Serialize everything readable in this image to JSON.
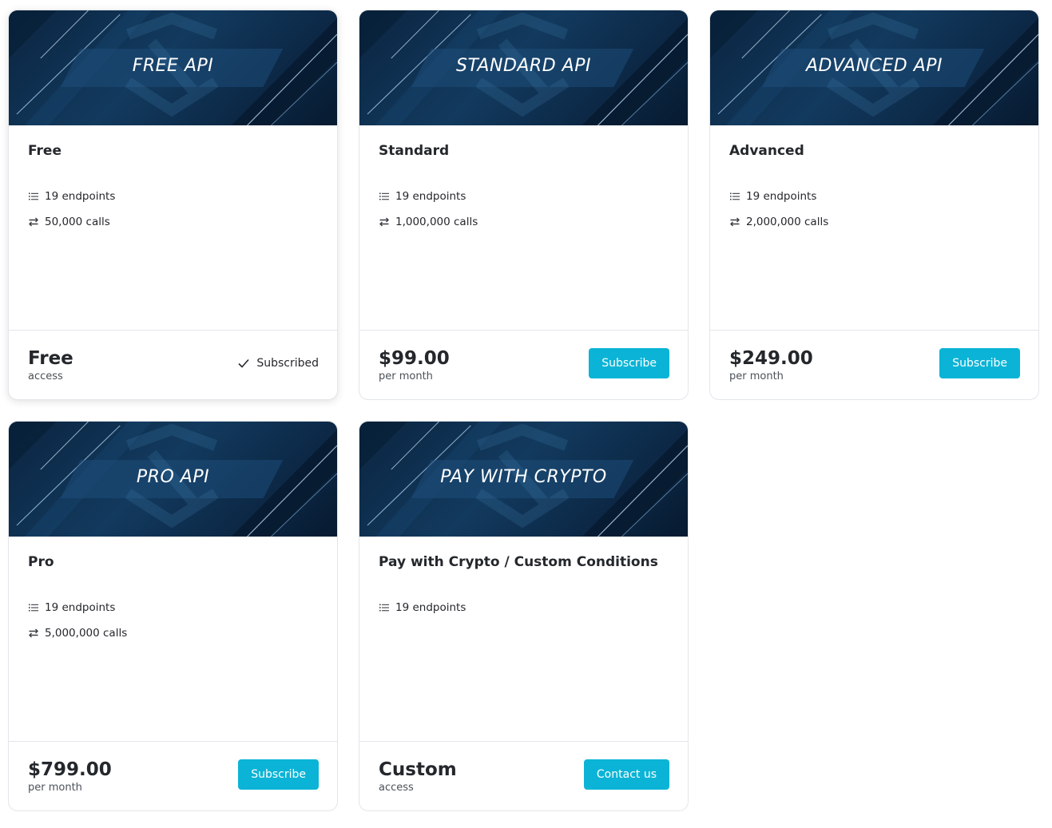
{
  "plans": [
    {
      "banner": "FREE API",
      "name": "Free",
      "endpoints": "19 endpoints",
      "calls": "50,000 calls",
      "price": "Free",
      "period": "access",
      "status": "Subscribed"
    },
    {
      "banner": "STANDARD API",
      "name": "Standard",
      "endpoints": "19 endpoints",
      "calls": "1,000,000 calls",
      "price": "$99.00",
      "period": "per month",
      "action": "Subscribe"
    },
    {
      "banner": "ADVANCED API",
      "name": "Advanced",
      "endpoints": "19 endpoints",
      "calls": "2,000,000 calls",
      "price": "$249.00",
      "period": "per month",
      "action": "Subscribe"
    },
    {
      "banner": "PRO API",
      "name": "Pro",
      "endpoints": "19 endpoints",
      "calls": "5,000,000 calls",
      "price": "$799.00",
      "period": "per month",
      "action": "Subscribe"
    },
    {
      "banner": "PAY WITH CRYPTO",
      "name": "Pay with Crypto / Custom Conditions",
      "endpoints": "19 endpoints",
      "price": "Custom",
      "period": "access",
      "action": "Contact us"
    }
  ],
  "icons": {
    "endpoints": "list-icon",
    "calls": "swap-arrows-icon",
    "status": "checkmark-icon"
  },
  "colors": {
    "accent": "#0bb4d6",
    "banner_dark": "#0b2440",
    "border": "#e3e6ea"
  }
}
